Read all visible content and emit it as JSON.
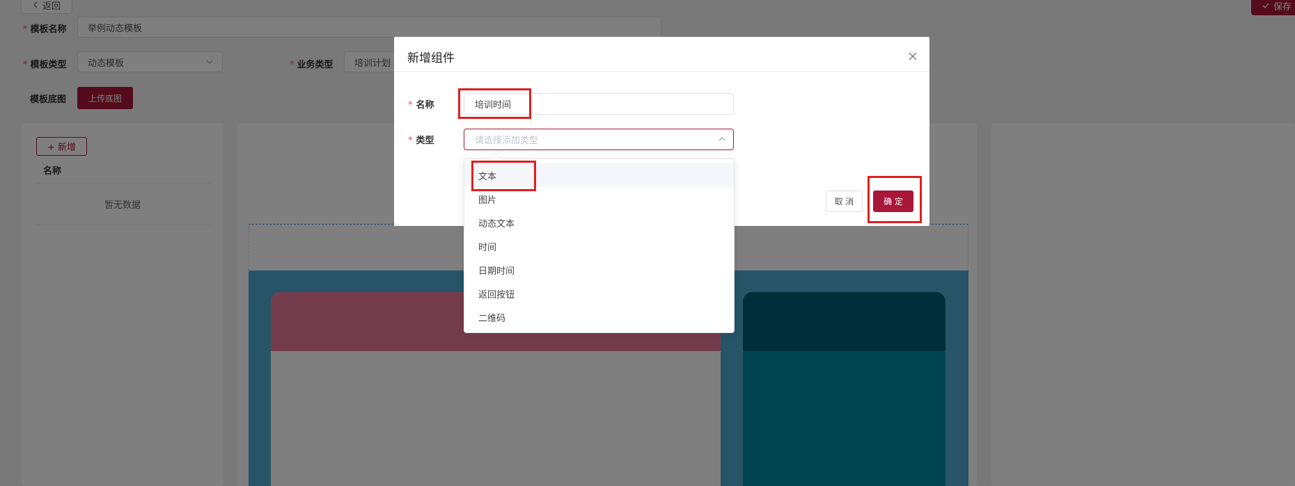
{
  "toolbar": {
    "back_label": "返回",
    "save_label": "保存"
  },
  "form": {
    "template_name_label": "模板名称",
    "template_name_value": "举例动态模板",
    "template_type_label": "模板类型",
    "template_type_value": "动态模板",
    "business_type_label": "业务类型",
    "business_type_value": "培训计划",
    "base_image_label": "模板底图",
    "upload_label": "上传底图"
  },
  "left_panel": {
    "add_label": "+ 新增",
    "column_name": "名称",
    "empty_text": "暂无数据"
  },
  "dialog": {
    "title": "新增组件",
    "name_label": "名称",
    "name_value": "培训时间",
    "type_label": "类型",
    "type_placeholder": "请选择添加类型",
    "cancel_label": "取 消",
    "ok_label": "确 定"
  },
  "dropdown": {
    "options": [
      "文本",
      "图片",
      "动态文本",
      "时间",
      "日期时间",
      "返回按钮",
      "二维码"
    ],
    "highlighted_index": 0
  },
  "colors": {
    "primary": "#a8163a",
    "highlight_box": "#e01e1e"
  }
}
